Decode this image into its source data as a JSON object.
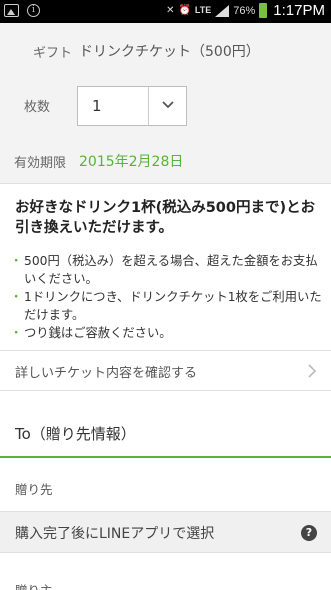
{
  "status_bar": {
    "battery_pct": "76%",
    "network": "LTE",
    "time": "1:17PM"
  },
  "gift": {
    "label": "ギフト",
    "value": "ドリンクチケット（500円）"
  },
  "quantity": {
    "label": "枚数",
    "value": "1"
  },
  "expiry": {
    "label": "有効期限",
    "value": "2015年2月28日"
  },
  "description": "お好きなドリンク1杯(税込み500円まで)とお引き換えいただけます。",
  "notes": [
    "500円（税込み）を超える場合、超えた金額をお支払いください。",
    "1ドリンクにつき、ドリンクチケット1枚をご利用いただけます。",
    "つり銭はご容赦ください。"
  ],
  "details_link": "詳しいチケット内容を確認する",
  "to_section": {
    "title": "To（贈り先情報）",
    "recipient_label": "贈り先",
    "recipient_value": "購入完了後にLINEアプリで選択",
    "sender_label": "贈り主"
  },
  "colors": {
    "accent": "#5bb336",
    "status_bar": "#000000",
    "battery": "#7ac143"
  }
}
